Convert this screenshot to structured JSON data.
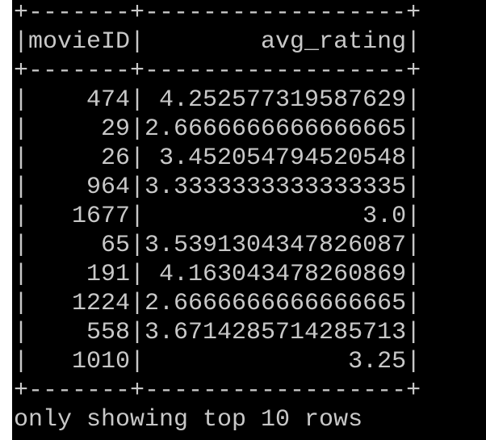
{
  "terminal": {
    "colors": {
      "background": "#000000",
      "text": "#c8c8c8"
    },
    "border_line": "+-------+------------------+",
    "header_line": "|movieID|        avg_rating|",
    "rows": [
      "|    474| 4.252577319587629|",
      "|     29|2.6666666666666665|",
      "|     26| 3.452054794520548|",
      "|    964|3.3333333333333335|",
      "|   1677|               3.0|",
      "|     65|3.5391304347826087|",
      "|    191| 4.163043478260869|",
      "|   1224|2.6666666666666665|",
      "|    558|3.6714285714285713|",
      "|   1010|              3.25|"
    ],
    "footer": "only showing top 10 rows"
  }
}
